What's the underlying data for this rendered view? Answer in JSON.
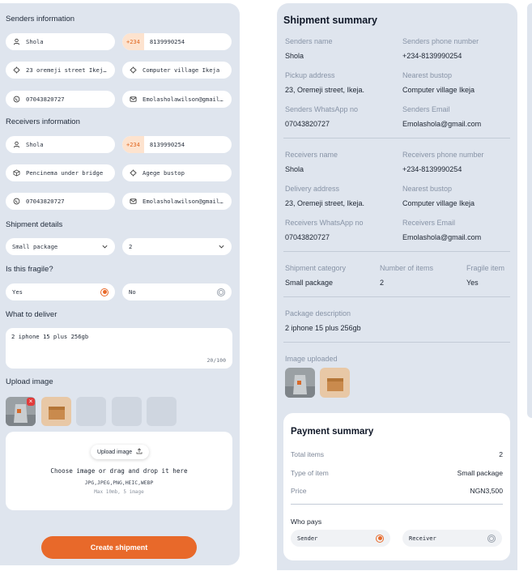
{
  "form": {
    "senders_title": "Senders information",
    "sender_name": "Shola",
    "sender_phone_prefix": "+234",
    "sender_phone": "8139990254",
    "sender_address": "23 oremeji street Ikeja ...",
    "sender_bustop": "Computer village Ikeja",
    "sender_whatsapp": "07043820727",
    "sender_email": "Emolasholawilson@gmail.com",
    "receivers_title": "Receivers information",
    "receiver_name": "Shola",
    "receiver_phone_prefix": "+234",
    "receiver_phone": "8139990254",
    "receiver_address": "Pencinema under bridge",
    "receiver_bustop": "Agege bustop",
    "receiver_whatsapp": "07043820727",
    "receiver_email": "Emolasholawilson@gmail.com",
    "shipment_title": "Shipment details",
    "package_type": "Small package",
    "item_count": "2",
    "fragile_title": "Is this fragile?",
    "fragile_yes": "Yes",
    "fragile_no": "No",
    "deliver_title": "What to deliver",
    "deliver_text": "2 iphone 15 plus 256gb",
    "deliver_counter": "20/100",
    "upload_title": "Upload image",
    "upload_button": "Upload image",
    "dropzone_main": "Choose image or drag and drop it here",
    "dropzone_formats": "JPG,JPEG,PNG,HEIC,WEBP",
    "dropzone_limits": "Max 10mb, 5 image",
    "create_button": "Create shipment"
  },
  "summary": {
    "title": "Shipment summary",
    "senders_name_label": "Senders name",
    "senders_name": "Shola",
    "senders_phone_label": "Senders phone number",
    "senders_phone": "+234-8139990254",
    "pickup_label": "Pickup address",
    "pickup": "23, Oremeji street, Ikeja.",
    "nearest_bustop_label": "Nearest bustop",
    "sender_bustop": "Computer village Ikeja",
    "senders_whatsapp_label": "Senders WhatsApp no",
    "senders_whatsapp": "07043820727",
    "senders_email_label": "Senders Email",
    "senders_email": "Emolashola@gmail.com",
    "receivers_name_label": "Receivers name",
    "receivers_name": "Shola",
    "receivers_phone_label": "Receivers phone number",
    "receivers_phone": "+234-8139990254",
    "delivery_label": "Delivery address",
    "delivery": "23, Oremeji street, Ikeja.",
    "receiver_bustop_label": "Nearest bustop",
    "receiver_bustop": "Computer village Ikeja",
    "receivers_whatsapp_label": "Receivers WhatsApp no",
    "receivers_whatsapp": "07043820727",
    "receivers_email_label": "Receivers Email",
    "receivers_email": "Emolashola@gmail.com",
    "category_label": "Shipment category",
    "category": "Small package",
    "items_label": "Number of items",
    "items": "2",
    "fragile_label": "Fragile item",
    "fragile": "Yes",
    "description_label": "Package description",
    "description": "2 iphone 15 plus 256gb",
    "image_label": "Image uploaded"
  },
  "payment": {
    "title": "Payment summary",
    "total_items_label": "Total items",
    "total_items": "2",
    "type_label": "Type of item",
    "type": "Small package",
    "price_label": "Price",
    "price": "NGN3,500",
    "who_pays_label": "Who pays",
    "sender_option": "Sender",
    "receiver_option": "Receiver"
  },
  "colors": {
    "accent": "#e8692a",
    "panel": "#dfe5ee"
  }
}
